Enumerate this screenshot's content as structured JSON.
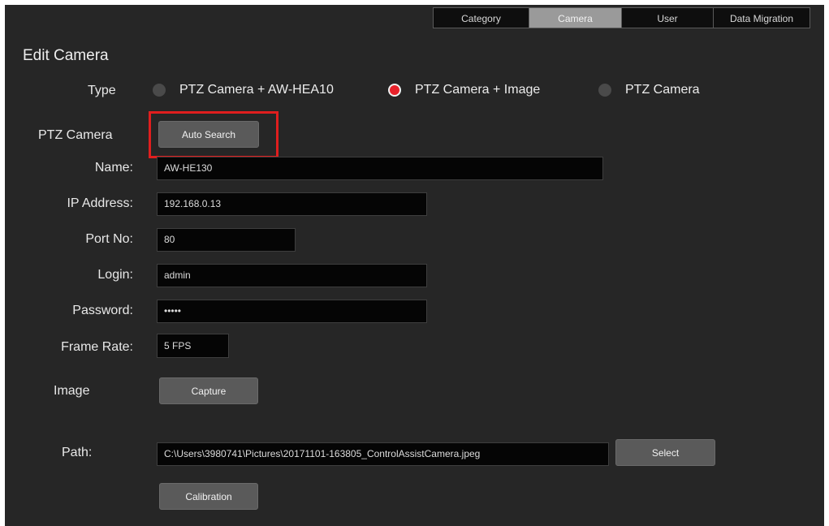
{
  "tabs": [
    {
      "label": "Category"
    },
    {
      "label": "Camera"
    },
    {
      "label": "User"
    },
    {
      "label": "Data Migration"
    }
  ],
  "title": "Edit Camera",
  "type": {
    "label": "Type",
    "options": [
      {
        "label": "PTZ Camera + AW-HEA10",
        "selected": false
      },
      {
        "label": "PTZ Camera + Image",
        "selected": true
      },
      {
        "label": "PTZ Camera",
        "selected": false
      }
    ]
  },
  "ptz_camera": {
    "label": "PTZ Camera",
    "auto_search_label": "Auto Search"
  },
  "fields": {
    "name": {
      "label": "Name:",
      "value": "AW-HE130"
    },
    "ip_address": {
      "label": "IP Address:",
      "value": "192.168.0.13"
    },
    "port": {
      "label": "Port No:",
      "value": "80"
    },
    "login": {
      "label": "Login:",
      "value": "admin"
    },
    "password": {
      "label": "Password:",
      "value": "•••••"
    },
    "frame_rate": {
      "label": "Frame Rate:",
      "value": "5 FPS"
    }
  },
  "image": {
    "label": "Image",
    "capture_label": "Capture"
  },
  "path": {
    "label": "Path:",
    "value": "C:\\Users\\3980741\\Pictures\\20171101-163805_ControlAssistCamera.jpeg",
    "select_label": "Select"
  },
  "calibration_label": "Calibration",
  "colors": {
    "background": "#262626",
    "accent_red": "#e01e1e",
    "active_tab": "#9a9a9a",
    "field_bg": "#050505"
  }
}
